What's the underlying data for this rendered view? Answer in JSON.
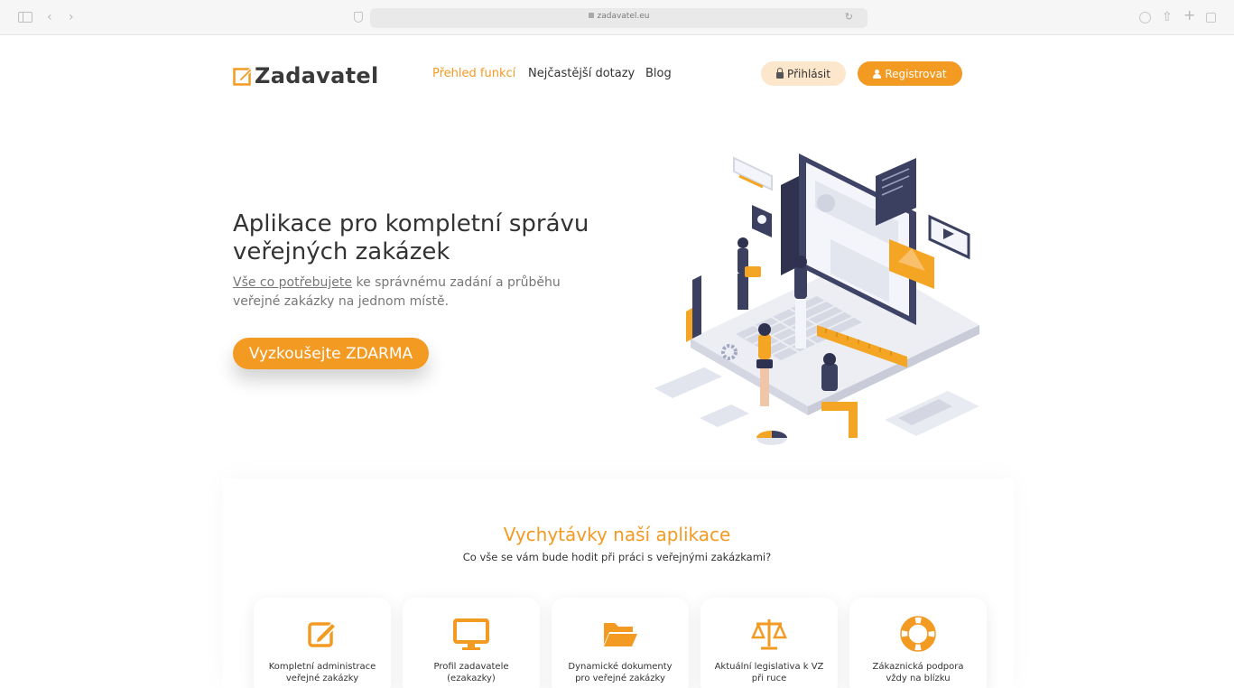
{
  "browser": {
    "url": "zadavatel.eu",
    "icons": [
      "sidebar-icon",
      "back-icon",
      "forward-icon",
      "shield-icon",
      "lock-icon",
      "reload-icon",
      "download-icon",
      "share-icon",
      "new-tab-icon",
      "tabs-icon"
    ]
  },
  "header": {
    "logo_text": "Zadavatel",
    "nav": [
      {
        "label": "Přehled funkcí",
        "active": true
      },
      {
        "label": "Nejčastější dotazy",
        "active": false
      },
      {
        "label": "Blog",
        "active": false
      }
    ],
    "login_label": "Přihlásit",
    "register_label": "Registrovat"
  },
  "hero": {
    "title_line1": "Aplikace pro kompletní správu",
    "title_line2": "veřejných zakázek",
    "subtitle_link": "Vše co potřebujete",
    "subtitle_rest": " ke správnému zadání a průběhu",
    "subtitle_line2": "veřejné zakázky na jednom místě.",
    "cta_label": "Vyzkoušejte ZDARMA"
  },
  "features": {
    "title": "Vychytávky naší aplikace",
    "subtitle": "Co vše se vám bude hodit při práci s veřejnými zakázkami?",
    "cards": [
      {
        "icon": "edit-icon",
        "line1": "Kompletní administrace",
        "line2": "veřejné zakázky"
      },
      {
        "icon": "monitor-icon",
        "line1": "Profil zadavatele",
        "line2": "(ezakazky)"
      },
      {
        "icon": "folder-icon",
        "line1": "Dynamické dokumenty",
        "line2": "pro veřejné zakázky"
      },
      {
        "icon": "scales-icon",
        "line1": "Aktuální legislativa k VZ",
        "line2": "při ruce"
      },
      {
        "icon": "lifebuoy-icon",
        "line1": "Zákaznická podpora",
        "line2": "vždy na blízku"
      }
    ]
  },
  "colors": {
    "accent": "#f39a23",
    "accent_light": "#fde7cc",
    "text": "#333333",
    "muted": "#777777"
  }
}
